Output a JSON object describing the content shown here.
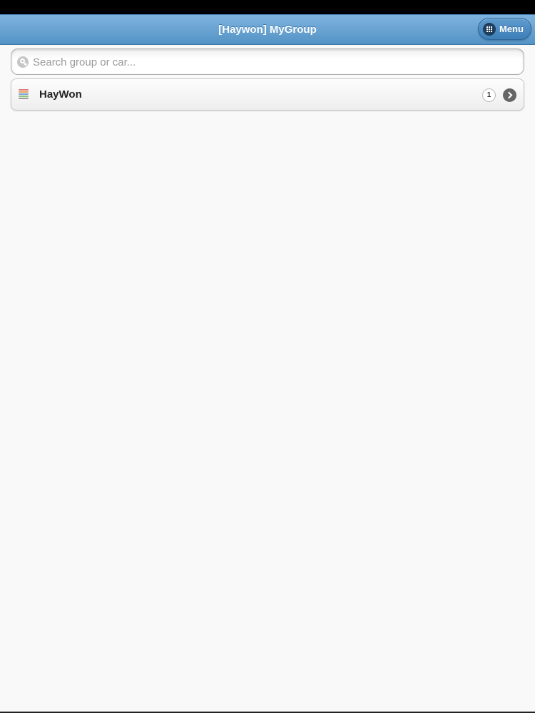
{
  "header": {
    "title": "[Haywon] MyGroup",
    "menu_label": "Menu",
    "menu_icon": "grid-icon",
    "color": "#5393c5"
  },
  "search": {
    "placeholder": "Search group or car...",
    "value": "",
    "icon": "search-icon"
  },
  "groups": [
    {
      "label": "HayWon",
      "count": "1",
      "icon": "group-icon",
      "chevron": "chevron-right-icon"
    }
  ]
}
